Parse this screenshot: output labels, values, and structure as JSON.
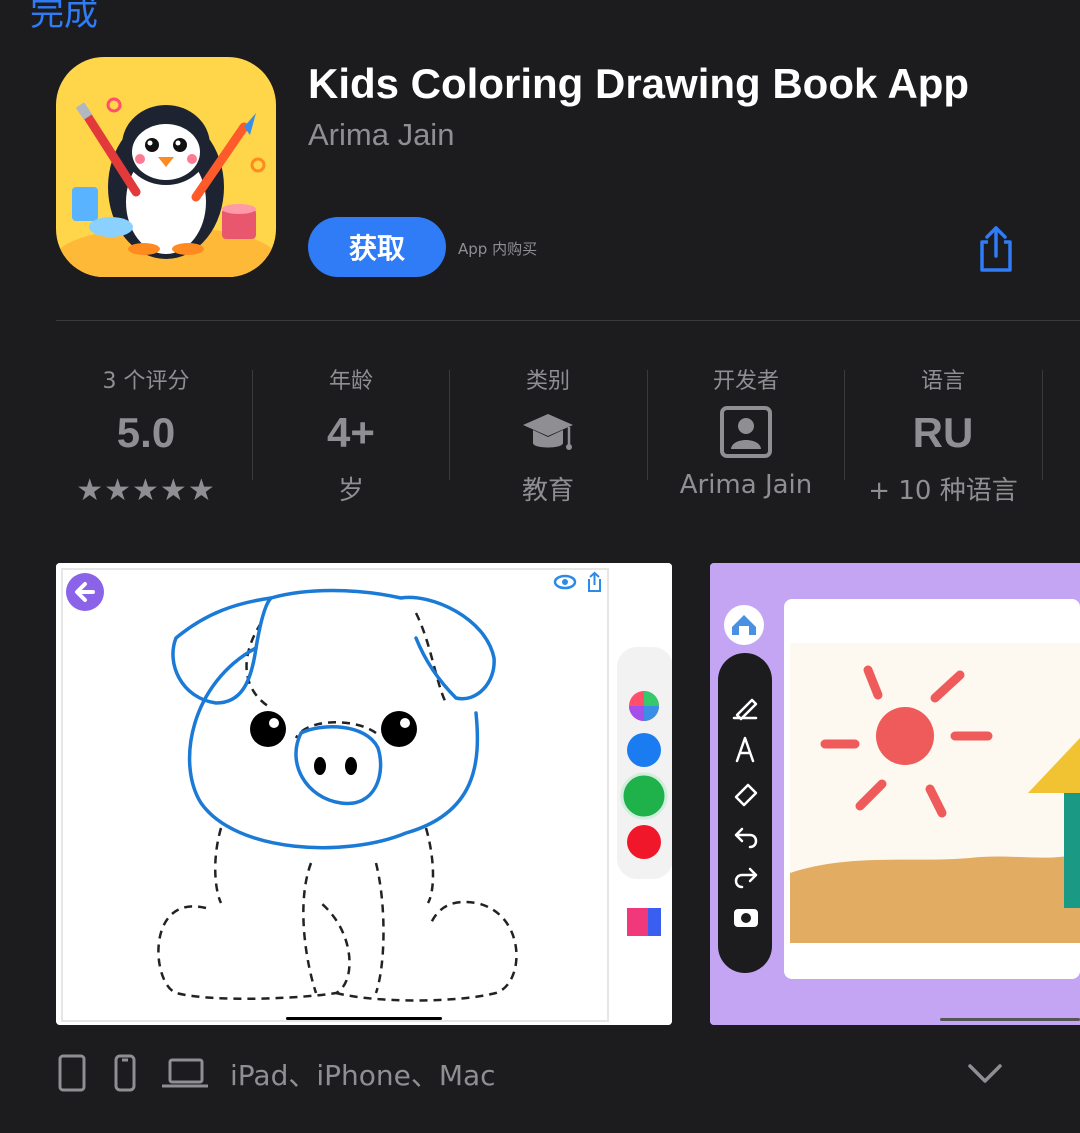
{
  "nav": {
    "done_label": "完成"
  },
  "app": {
    "title": "Kids Coloring Drawing Book App",
    "developer": "Arima Jain",
    "get_label": "获取",
    "iap_label": "App 内购买"
  },
  "stats": {
    "ratings": {
      "label": "3 个评分",
      "value": "5.0",
      "stars": 5
    },
    "age": {
      "label": "年龄",
      "value": "4+",
      "sub": "岁"
    },
    "category": {
      "label": "类别",
      "icon": "graduation-cap-icon",
      "sub": "教育"
    },
    "developer": {
      "label": "开发者",
      "icon": "person-icon",
      "sub": "Arima Jain"
    },
    "language": {
      "label": "语言",
      "value": "RU",
      "sub": "+ 10 种语言"
    }
  },
  "screenshots": [
    {
      "subject": "pig-coloring-page",
      "palette": [
        "rainbow",
        "#1a7cf0",
        "#1fb24a",
        "#f0172a"
      ]
    },
    {
      "subject": "sun-landscape-drawing",
      "tools": [
        "pencil-icon",
        "pen-icon",
        "eraser-icon",
        "undo-icon",
        "redo-icon",
        "camera-icon"
      ]
    }
  ],
  "devices": {
    "text": "iPad、iPhone、Mac"
  },
  "colors": {
    "accent": "#2f7cf6",
    "background": "#1c1c1e",
    "secondary_text": "#8e8e93"
  }
}
